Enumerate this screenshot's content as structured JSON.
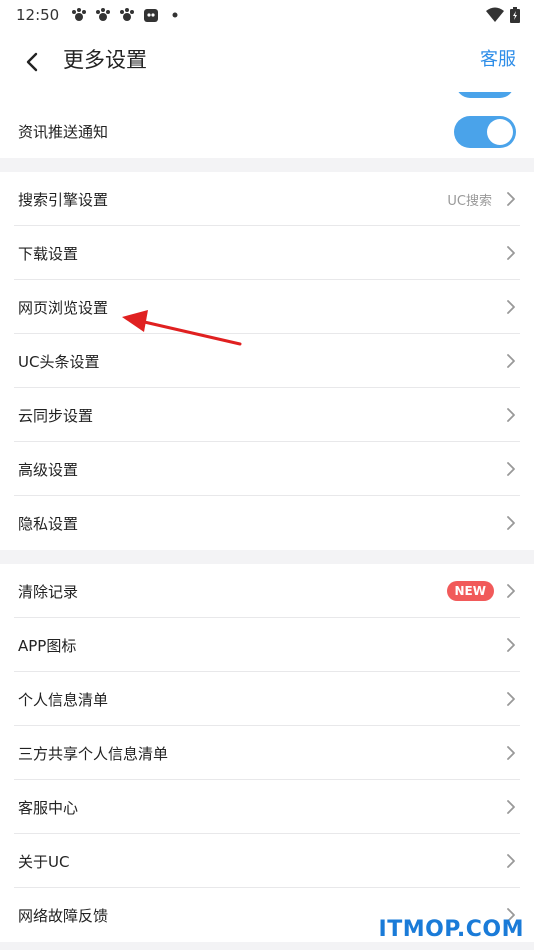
{
  "status": {
    "time": "12:50"
  },
  "header": {
    "title": "更多设置",
    "service": "客服"
  },
  "group1": {
    "push_label": "资讯推送通知",
    "push_on": true
  },
  "group2": [
    {
      "label": "搜索引擎设置",
      "value": "UC搜索"
    },
    {
      "label": "下载设置"
    },
    {
      "label": "网页浏览设置"
    },
    {
      "label": "UC头条设置"
    },
    {
      "label": "云同步设置"
    },
    {
      "label": "高级设置"
    },
    {
      "label": "隐私设置"
    }
  ],
  "group3": [
    {
      "label": "清除记录",
      "badge": "NEW"
    },
    {
      "label": "APP图标"
    },
    {
      "label": "个人信息清单"
    },
    {
      "label": "三方共享个人信息清单"
    },
    {
      "label": "客服中心"
    },
    {
      "label": "关于UC"
    },
    {
      "label": "网络故障反馈"
    }
  ],
  "watermark": "ITMOP.COM",
  "colors": {
    "accent": "#2f8ee8",
    "toggle": "#4aa3ea",
    "badge": "#f15a5a",
    "annotation": "#e02020"
  }
}
